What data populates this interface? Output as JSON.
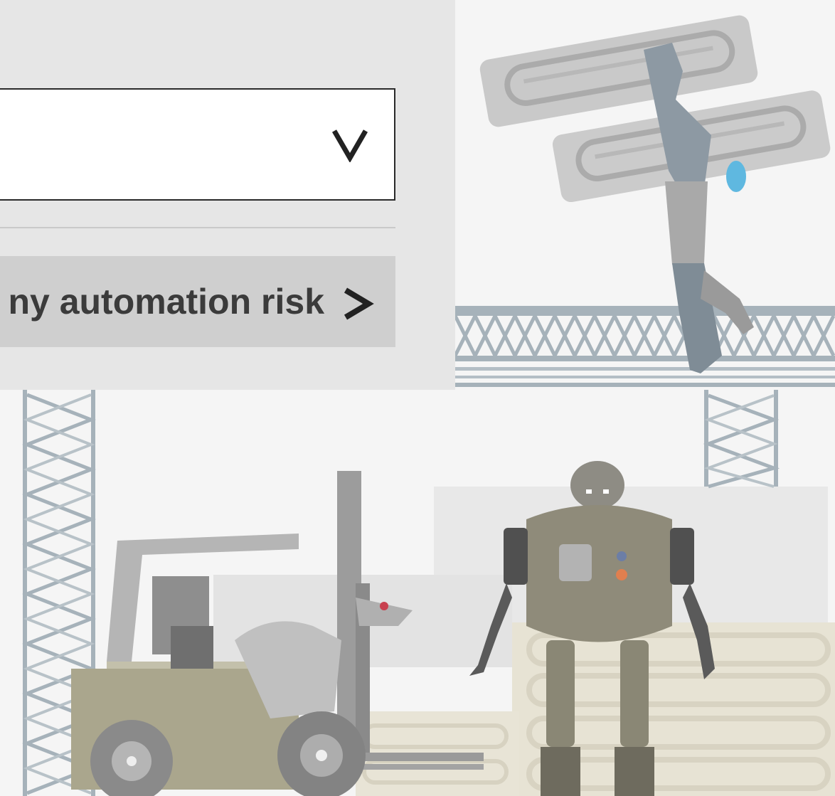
{
  "selector": {
    "value": "",
    "icon": "chevron-down-icon"
  },
  "cta": {
    "label": "ny automation risk",
    "icon": "chevron-right-icon"
  },
  "illustration": {
    "colors": {
      "panel": "#e6e6e6",
      "scaffold": "#a6b2ba",
      "robot_body": "#8f8b7a",
      "forklift": "#a9a58c",
      "crates": "#e7e3d4"
    }
  }
}
